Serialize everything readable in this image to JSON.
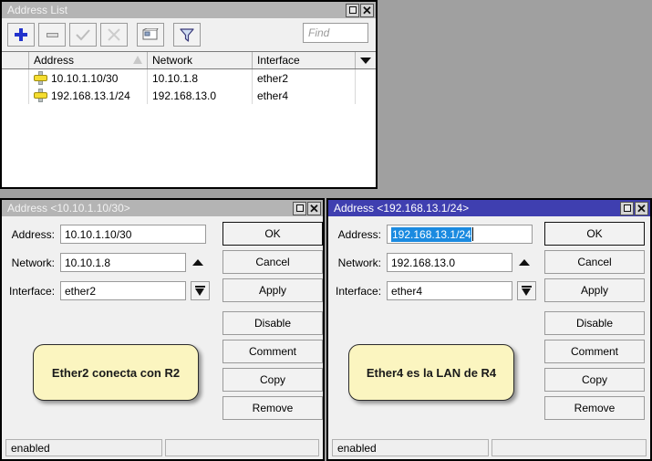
{
  "desktop": {
    "background_color": "#a0a0a0"
  },
  "address_list_window": {
    "title": "Address List",
    "active": false,
    "window_buttons": {
      "maximize": "maximize-icon",
      "close": "close-icon"
    },
    "toolbar": {
      "buttons": [
        {
          "name": "add-button",
          "icon": "plus-icon",
          "enabled": true
        },
        {
          "name": "remove-button",
          "icon": "minus-icon",
          "enabled": true
        },
        {
          "name": "enable-button",
          "icon": "check-icon",
          "enabled": false
        },
        {
          "name": "disable-button",
          "icon": "cross-icon",
          "enabled": false
        },
        {
          "name": "comment-button",
          "icon": "note-icon",
          "enabled": true
        },
        {
          "name": "filter-button",
          "icon": "funnel-icon",
          "enabled": true
        }
      ],
      "find_placeholder": "Find",
      "find_value": ""
    },
    "table": {
      "columns": [
        "",
        "Address",
        "Network",
        "Interface",
        ""
      ],
      "sort_column": "Address",
      "rows": [
        {
          "icon": "address-icon",
          "address": "10.10.1.10/30",
          "network": "10.10.1.8",
          "interface": "ether2"
        },
        {
          "icon": "address-icon",
          "address": "192.168.13.1/24",
          "network": "192.168.13.0",
          "interface": "ether4"
        }
      ]
    }
  },
  "dialog_left": {
    "title": "Address <10.10.1.10/30>",
    "active": false,
    "fields": {
      "address_label": "Address:",
      "address_value": "10.10.1.10/30",
      "address_selected": false,
      "network_label": "Network:",
      "network_value": "10.10.1.8",
      "interface_label": "Interface:",
      "interface_value": "ether2"
    },
    "comment_bubble": "Ether2 conecta con R2",
    "buttons": [
      "OK",
      "Cancel",
      "Apply",
      "Disable",
      "Comment",
      "Copy",
      "Remove"
    ],
    "status": {
      "left": "enabled",
      "right": ""
    }
  },
  "dialog_right": {
    "title": "Address <192.168.13.1/24>",
    "active": true,
    "fields": {
      "address_label": "Address:",
      "address_value": "192.168.13.1/24",
      "address_selected": true,
      "network_label": "Network:",
      "network_value": "192.168.13.0",
      "interface_label": "Interface:",
      "interface_value": "ether4"
    },
    "comment_bubble": "Ether4 es la LAN de R4",
    "buttons": [
      "OK",
      "Cancel",
      "Apply",
      "Disable",
      "Comment",
      "Copy",
      "Remove"
    ],
    "status": {
      "left": "enabled",
      "right": ""
    }
  },
  "colors": {
    "active_titlebar": "#3f3fb0",
    "inactive_titlebar": "#b4b4b4",
    "selection": "#1a8ae0",
    "bubble_fill": "#fbf5c0",
    "address_icon": "#f5dd30",
    "accent_plus": "#2233cc"
  }
}
